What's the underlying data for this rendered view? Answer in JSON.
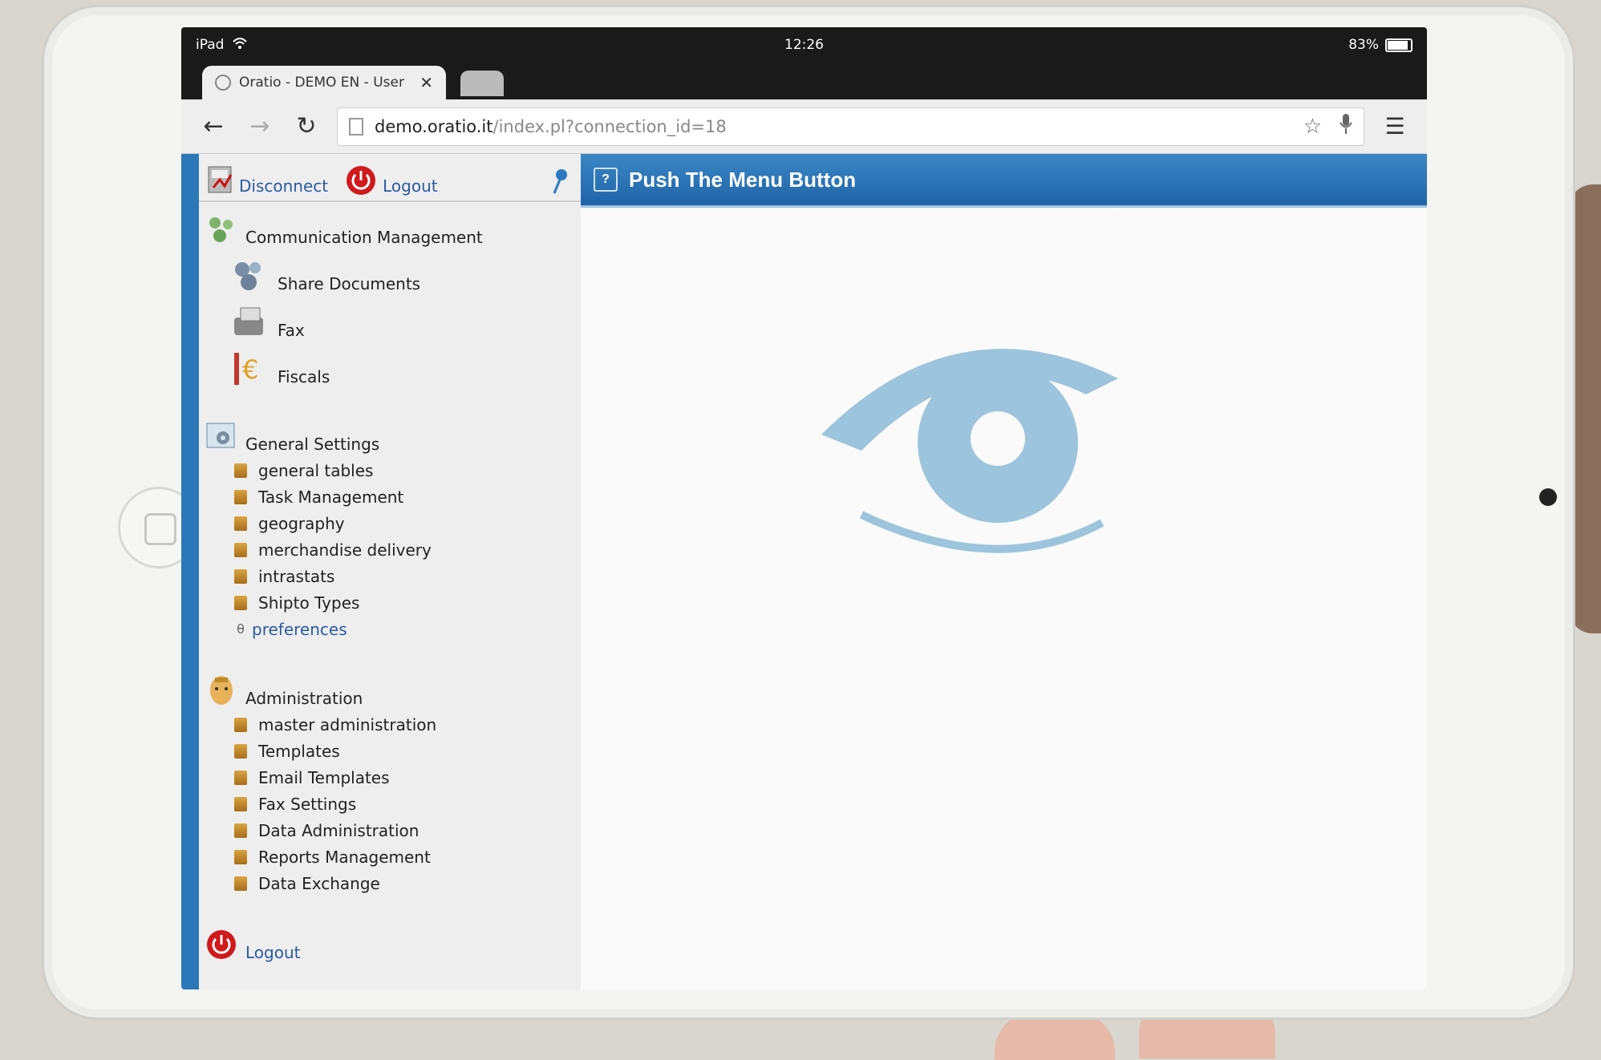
{
  "status_bar": {
    "device": "iPad",
    "time": "12:26",
    "battery": "83%",
    "battery_level": 0.83
  },
  "browser": {
    "tab_title": "Oratio - DEMO EN - User",
    "tab_close": "✕",
    "url_host": "demo.oratio.it",
    "url_path": "/index.pl?connection_id=18"
  },
  "sidebar": {
    "top": {
      "disconnect": "Disconnect",
      "logout": "Logout"
    },
    "communication": {
      "title": "Communication Management",
      "items": [
        "Share Documents",
        "Fax",
        "Fiscals"
      ]
    },
    "general_settings": {
      "title": "General Settings",
      "items": [
        "general tables",
        "Task Management",
        "geography",
        "merchandise delivery",
        "intrastats",
        "Shipto Types"
      ],
      "link": "preferences"
    },
    "administration": {
      "title": "Administration",
      "items": [
        "master administration",
        "Templates",
        "Email Templates",
        "Fax Settings",
        "Data Administration",
        "Reports Management",
        "Data Exchange"
      ]
    },
    "bottom_logout": "Logout"
  },
  "main": {
    "header": "Push The Menu Button",
    "help_icon": "?"
  },
  "colors": {
    "accent": "#1f64a8",
    "link": "#2a5aa0",
    "eye": "#9cc4dd",
    "strip": "#2b78b8"
  }
}
